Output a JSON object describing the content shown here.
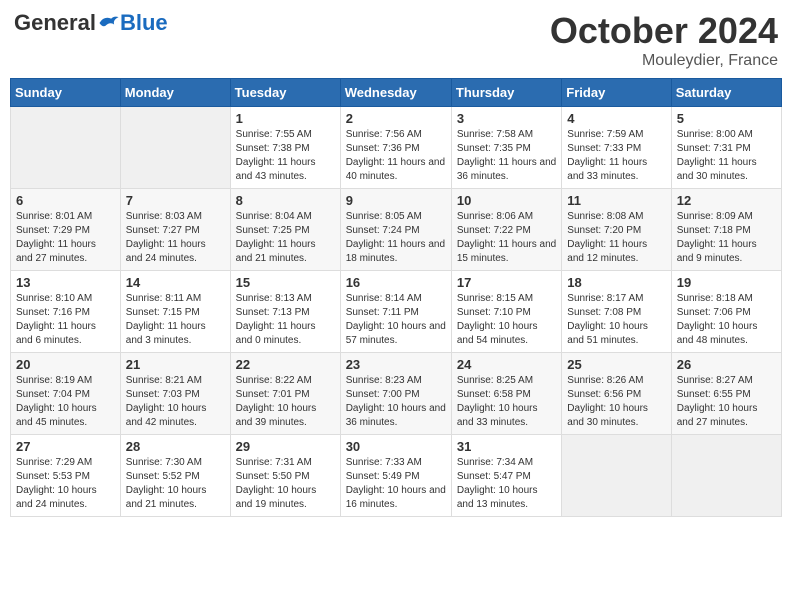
{
  "header": {
    "logo": {
      "general": "General",
      "blue": "Blue"
    },
    "title": "October 2024",
    "subtitle": "Mouleydier, France"
  },
  "weekdays": [
    "Sunday",
    "Monday",
    "Tuesday",
    "Wednesday",
    "Thursday",
    "Friday",
    "Saturday"
  ],
  "weeks": [
    [
      {
        "day": "",
        "info": ""
      },
      {
        "day": "",
        "info": ""
      },
      {
        "day": "1",
        "info": "Sunrise: 7:55 AM\nSunset: 7:38 PM\nDaylight: 11 hours and 43 minutes."
      },
      {
        "day": "2",
        "info": "Sunrise: 7:56 AM\nSunset: 7:36 PM\nDaylight: 11 hours and 40 minutes."
      },
      {
        "day": "3",
        "info": "Sunrise: 7:58 AM\nSunset: 7:35 PM\nDaylight: 11 hours and 36 minutes."
      },
      {
        "day": "4",
        "info": "Sunrise: 7:59 AM\nSunset: 7:33 PM\nDaylight: 11 hours and 33 minutes."
      },
      {
        "day": "5",
        "info": "Sunrise: 8:00 AM\nSunset: 7:31 PM\nDaylight: 11 hours and 30 minutes."
      }
    ],
    [
      {
        "day": "6",
        "info": "Sunrise: 8:01 AM\nSunset: 7:29 PM\nDaylight: 11 hours and 27 minutes."
      },
      {
        "day": "7",
        "info": "Sunrise: 8:03 AM\nSunset: 7:27 PM\nDaylight: 11 hours and 24 minutes."
      },
      {
        "day": "8",
        "info": "Sunrise: 8:04 AM\nSunset: 7:25 PM\nDaylight: 11 hours and 21 minutes."
      },
      {
        "day": "9",
        "info": "Sunrise: 8:05 AM\nSunset: 7:24 PM\nDaylight: 11 hours and 18 minutes."
      },
      {
        "day": "10",
        "info": "Sunrise: 8:06 AM\nSunset: 7:22 PM\nDaylight: 11 hours and 15 minutes."
      },
      {
        "day": "11",
        "info": "Sunrise: 8:08 AM\nSunset: 7:20 PM\nDaylight: 11 hours and 12 minutes."
      },
      {
        "day": "12",
        "info": "Sunrise: 8:09 AM\nSunset: 7:18 PM\nDaylight: 11 hours and 9 minutes."
      }
    ],
    [
      {
        "day": "13",
        "info": "Sunrise: 8:10 AM\nSunset: 7:16 PM\nDaylight: 11 hours and 6 minutes."
      },
      {
        "day": "14",
        "info": "Sunrise: 8:11 AM\nSunset: 7:15 PM\nDaylight: 11 hours and 3 minutes."
      },
      {
        "day": "15",
        "info": "Sunrise: 8:13 AM\nSunset: 7:13 PM\nDaylight: 11 hours and 0 minutes."
      },
      {
        "day": "16",
        "info": "Sunrise: 8:14 AM\nSunset: 7:11 PM\nDaylight: 10 hours and 57 minutes."
      },
      {
        "day": "17",
        "info": "Sunrise: 8:15 AM\nSunset: 7:10 PM\nDaylight: 10 hours and 54 minutes."
      },
      {
        "day": "18",
        "info": "Sunrise: 8:17 AM\nSunset: 7:08 PM\nDaylight: 10 hours and 51 minutes."
      },
      {
        "day": "19",
        "info": "Sunrise: 8:18 AM\nSunset: 7:06 PM\nDaylight: 10 hours and 48 minutes."
      }
    ],
    [
      {
        "day": "20",
        "info": "Sunrise: 8:19 AM\nSunset: 7:04 PM\nDaylight: 10 hours and 45 minutes."
      },
      {
        "day": "21",
        "info": "Sunrise: 8:21 AM\nSunset: 7:03 PM\nDaylight: 10 hours and 42 minutes."
      },
      {
        "day": "22",
        "info": "Sunrise: 8:22 AM\nSunset: 7:01 PM\nDaylight: 10 hours and 39 minutes."
      },
      {
        "day": "23",
        "info": "Sunrise: 8:23 AM\nSunset: 7:00 PM\nDaylight: 10 hours and 36 minutes."
      },
      {
        "day": "24",
        "info": "Sunrise: 8:25 AM\nSunset: 6:58 PM\nDaylight: 10 hours and 33 minutes."
      },
      {
        "day": "25",
        "info": "Sunrise: 8:26 AM\nSunset: 6:56 PM\nDaylight: 10 hours and 30 minutes."
      },
      {
        "day": "26",
        "info": "Sunrise: 8:27 AM\nSunset: 6:55 PM\nDaylight: 10 hours and 27 minutes."
      }
    ],
    [
      {
        "day": "27",
        "info": "Sunrise: 7:29 AM\nSunset: 5:53 PM\nDaylight: 10 hours and 24 minutes."
      },
      {
        "day": "28",
        "info": "Sunrise: 7:30 AM\nSunset: 5:52 PM\nDaylight: 10 hours and 21 minutes."
      },
      {
        "day": "29",
        "info": "Sunrise: 7:31 AM\nSunset: 5:50 PM\nDaylight: 10 hours and 19 minutes."
      },
      {
        "day": "30",
        "info": "Sunrise: 7:33 AM\nSunset: 5:49 PM\nDaylight: 10 hours and 16 minutes."
      },
      {
        "day": "31",
        "info": "Sunrise: 7:34 AM\nSunset: 5:47 PM\nDaylight: 10 hours and 13 minutes."
      },
      {
        "day": "",
        "info": ""
      },
      {
        "day": "",
        "info": ""
      }
    ]
  ]
}
